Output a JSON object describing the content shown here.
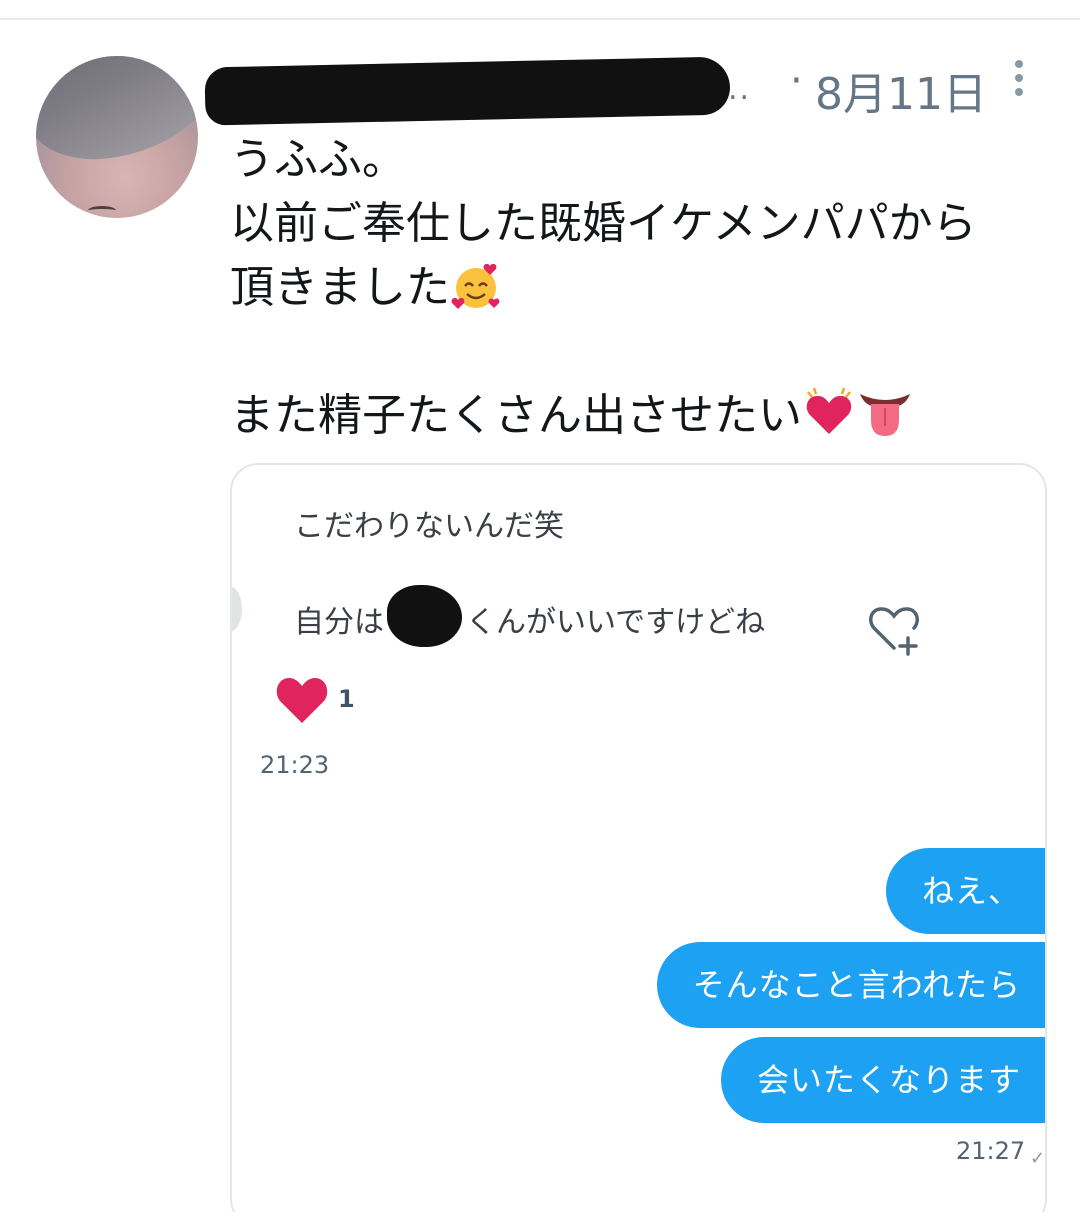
{
  "tweet": {
    "date": "8月11日",
    "separator": "·",
    "name_ellipsis": "..",
    "lines": [
      "うふふ。",
      "以前ご奉仕した既婚イケメンパパから",
      "頂きました",
      "",
      "また精子たくさん出させたい"
    ],
    "emojis": [
      "smiling-face-with-hearts-icon",
      "beating-heart-icon",
      "tongue-icon"
    ]
  },
  "dm": {
    "messages_received": [
      "こだわりないんだ笑",
      "自分は",
      "くんがいいですけどね"
    ],
    "like_count": "1",
    "received_time": "21:23",
    "messages_sent": [
      "ねえ、",
      "そんなこと言われたら",
      "会いたくなります"
    ],
    "sent_time": "21:27",
    "sent_check": "✓"
  },
  "colors": {
    "accent": "#1da1f2",
    "like": "#e0245e",
    "secondary_text": "#657786",
    "text": "#14171a"
  }
}
